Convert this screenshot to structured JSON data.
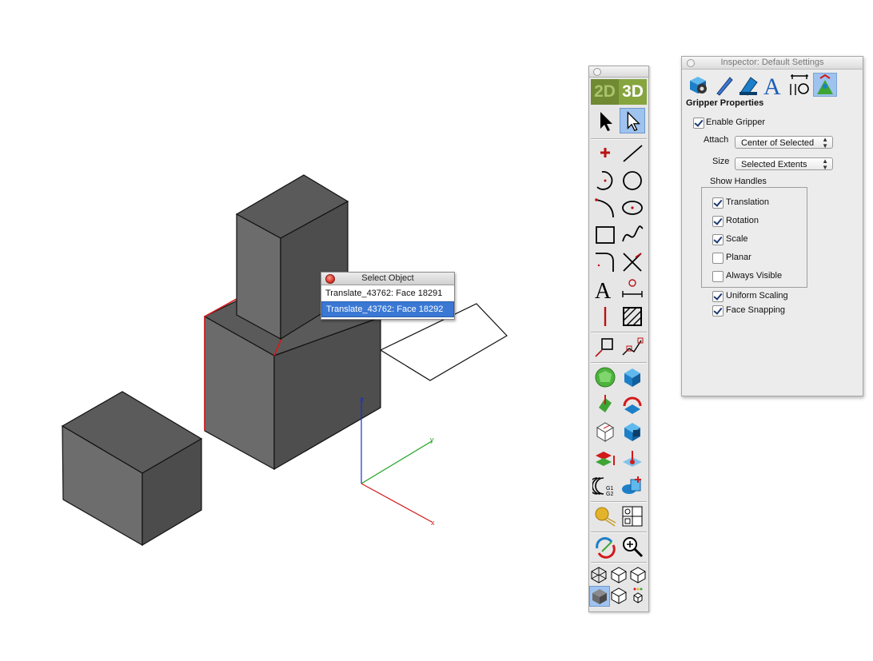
{
  "viewport": {
    "axes": {
      "x_label": "x",
      "y_label": "y",
      "z_label": "z"
    },
    "colors": {
      "box_top": "#5a5a5a",
      "box_left": "#6b6b6b",
      "box_right": "#4d4d4d",
      "highlight": "#d21a1a"
    }
  },
  "select_object": {
    "title": "Select Object",
    "items": [
      "Translate_43762: Face 18291",
      "Translate_43762: Face 18292"
    ],
    "selected_index": 1
  },
  "palette": {
    "tab_2d": "2D",
    "tab_3d": "3D",
    "tools": [
      "select-arrow",
      "select-arrow-hollow",
      "point",
      "line",
      "arc",
      "circle",
      "arc-3pt",
      "ellipse",
      "rectangle",
      "spline",
      "fillet",
      "trim",
      "text",
      "dimension",
      "centerline",
      "hatch",
      "transform",
      "snap-to",
      "sphere",
      "box",
      "extrude",
      "revolve",
      "shell",
      "boolean",
      "layer-move",
      "pull",
      "loft",
      "boolean-union",
      "render",
      "views",
      "orbit",
      "zoom",
      "wireframe",
      "hidden-line",
      "shaded",
      "shaded-solid",
      "outline",
      "small-cubes"
    ]
  },
  "inspector": {
    "title": "Inspector: Default Settings",
    "section_title": "Gripper Properties",
    "enable_gripper": {
      "label": "Enable Gripper",
      "checked": true
    },
    "attach": {
      "label": "Attach",
      "value": "Center of Selected"
    },
    "size": {
      "label": "Size",
      "value": "Selected Extents"
    },
    "show_handles": {
      "label": "Show Handles",
      "items": [
        {
          "label": "Translation",
          "checked": true
        },
        {
          "label": "Rotation",
          "checked": true
        },
        {
          "label": "Scale",
          "checked": true
        },
        {
          "label": "Planar",
          "checked": false
        },
        {
          "label": "Always Visible",
          "checked": false
        }
      ]
    },
    "uniform_scaling": {
      "label": "Uniform Scaling",
      "checked": true
    },
    "face_snapping": {
      "label": "Face Snapping",
      "checked": true
    },
    "icons": [
      "object-settings-icon",
      "pen-icon",
      "paint-icon",
      "text-icon",
      "dimension-icon",
      "gripper-icon"
    ]
  }
}
